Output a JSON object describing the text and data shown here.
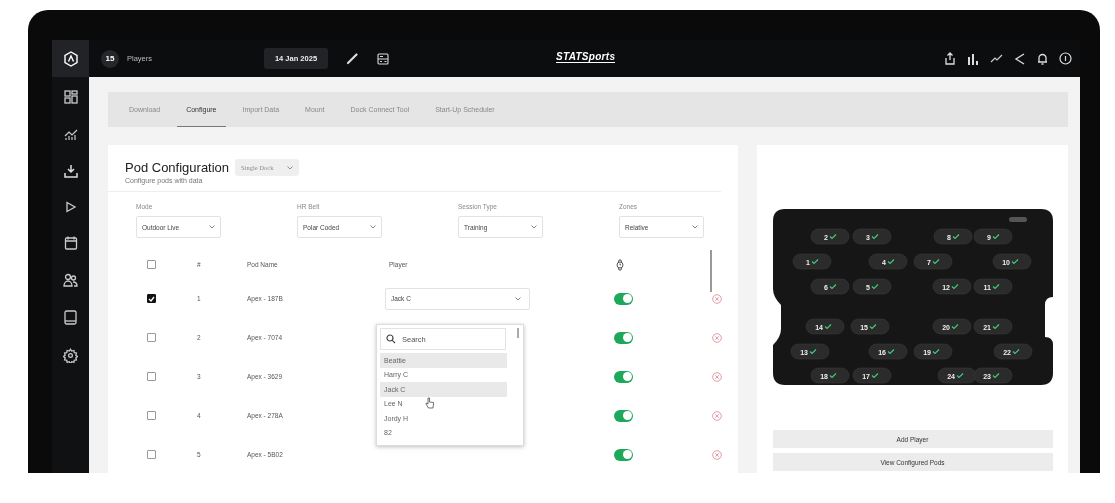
{
  "top_bar": {
    "player_count": "15",
    "players_label": "Players",
    "date": "14 Jan 2025",
    "logo": "STATSports"
  },
  "tabs": [
    {
      "label": "Download",
      "selected": false
    },
    {
      "label": "Configure",
      "selected": true
    },
    {
      "label": "Import Data",
      "selected": false
    },
    {
      "label": "Mount",
      "selected": false
    },
    {
      "label": "Dock Connect Tool",
      "selected": false
    },
    {
      "label": "Start-Up Scheduler",
      "selected": false
    }
  ],
  "pod_configuration": {
    "title": "Pod Configuration",
    "subtitle": "Configure pods with data",
    "dock_select": {
      "value": "Single Dock",
      "disabled": true
    }
  },
  "filters": [
    {
      "label": "Mode",
      "value": "Outdoor Live"
    },
    {
      "label": "HR Belt",
      "value": "Polar Coded"
    },
    {
      "label": "Session Type",
      "value": "Training"
    },
    {
      "label": "Zones",
      "value": "Relative"
    }
  ],
  "table": {
    "header_checked": false,
    "columns": [
      "#",
      "Pod Name",
      "Player"
    ],
    "rows": [
      {
        "checked": true,
        "number": "1",
        "pod_name": "Apex - 187B",
        "player": "Jack C",
        "enabled": true
      },
      {
        "checked": false,
        "number": "2",
        "pod_name": "Apex - 7074",
        "enabled": true
      },
      {
        "checked": false,
        "number": "3",
        "pod_name": "Apex - 3629",
        "enabled": true
      },
      {
        "checked": false,
        "number": "4",
        "pod_name": "Apex - 278A",
        "enabled": true
      },
      {
        "checked": false,
        "number": "5",
        "pod_name": "Apex - 5B02",
        "enabled": true
      }
    ]
  },
  "player_dropdown": {
    "placeholder": "Search",
    "options": [
      {
        "label": "Beattie",
        "highlighted": true
      },
      {
        "label": "Harry C",
        "highlighted": false
      },
      {
        "label": "Jack C",
        "highlighted": true
      },
      {
        "label": "Lee N",
        "highlighted": false
      },
      {
        "label": "Jordy H",
        "highlighted": false
      },
      {
        "label": "82",
        "highlighted": false
      }
    ]
  },
  "dock": {
    "pods": [
      {
        "label": "2",
        "ready": true
      },
      {
        "label": "3",
        "ready": true
      },
      {
        "label": "8",
        "ready": true
      },
      {
        "label": "9",
        "ready": true
      },
      {
        "label": "1",
        "ready": true
      },
      {
        "label": "4",
        "ready": true
      },
      {
        "label": "7",
        "ready": true
      },
      {
        "label": "10",
        "ready": true
      },
      {
        "label": "6",
        "ready": true
      },
      {
        "label": "5",
        "ready": true
      },
      {
        "label": "12",
        "ready": true
      },
      {
        "label": "11",
        "ready": true
      },
      {
        "label": "14",
        "ready": true
      },
      {
        "label": "15",
        "ready": true
      },
      {
        "label": "20",
        "ready": true
      },
      {
        "label": "21",
        "ready": true
      },
      {
        "label": "13",
        "ready": true
      },
      {
        "label": "16",
        "ready": true
      },
      {
        "label": "19",
        "ready": true
      },
      {
        "label": "22",
        "ready": true
      },
      {
        "label": "18",
        "ready": true
      },
      {
        "label": "17",
        "ready": true
      },
      {
        "label": "24",
        "ready": true
      },
      {
        "label": "23",
        "ready": true
      }
    ]
  },
  "buttons": [
    "Add Player",
    "View Configured Pods"
  ]
}
